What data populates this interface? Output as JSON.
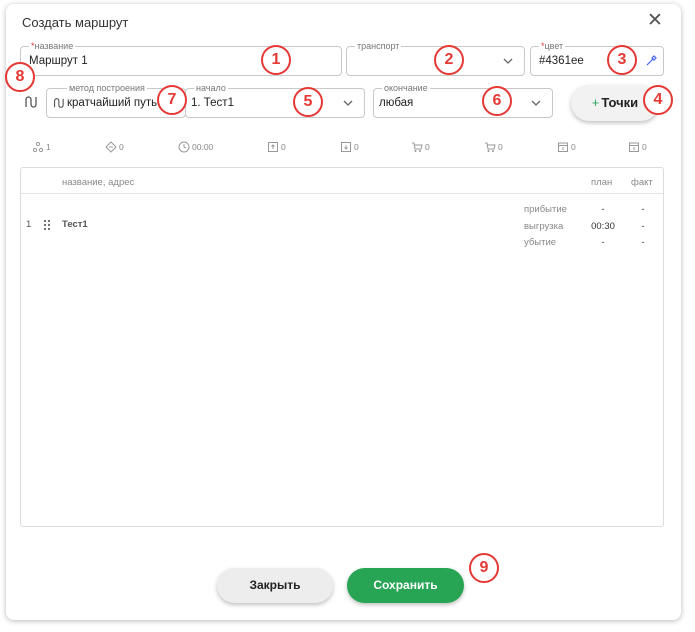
{
  "dialog": {
    "title": "Создать маршрут",
    "close_icon": "close-icon"
  },
  "form": {
    "name": {
      "label": "название",
      "required": "*",
      "value": "Маршрут 1"
    },
    "transport": {
      "label": "транспорт",
      "value": ""
    },
    "color": {
      "label": "цвет",
      "required": "*",
      "value": "#4361ee",
      "icon": "eyedropper-icon"
    },
    "method": {
      "label": "метод построения",
      "value": "кратчайший путь",
      "icon": "route-icon"
    },
    "start": {
      "label": "начало",
      "value": "1. Тест1"
    },
    "end": {
      "label": "окончание",
      "value": "любая"
    },
    "points_button": {
      "plus": "+",
      "label": "Точки"
    },
    "route_toggle_icon": "route-icon"
  },
  "stats": [
    {
      "icon": "points-count-icon",
      "value": "1"
    },
    {
      "icon": "distance-icon",
      "value": "0"
    },
    {
      "icon": "clock-icon",
      "value": "00:00"
    },
    {
      "icon": "load-icon",
      "value": "0"
    },
    {
      "icon": "unload-icon",
      "value": "0"
    },
    {
      "icon": "cart-load-icon",
      "value": "0"
    },
    {
      "icon": "cart-unload-icon",
      "value": "0"
    },
    {
      "icon": "box-in-icon",
      "value": "0"
    },
    {
      "icon": "box-out-icon",
      "value": "0"
    }
  ],
  "table": {
    "headers": {
      "name": "название, адрес",
      "plan": "план",
      "fact": "факт"
    },
    "rows": [
      {
        "num": "1",
        "name": "Тест1",
        "labels": [
          "прибытие",
          "выгрузка",
          "убытие"
        ],
        "plan": [
          "-",
          "00:30",
          "-"
        ],
        "fact": [
          "-",
          "-",
          "-"
        ]
      }
    ]
  },
  "buttons": {
    "close": "Закрыть",
    "save": "Сохранить"
  },
  "annotations": [
    "1",
    "2",
    "3",
    "4",
    "5",
    "6",
    "7",
    "8",
    "9"
  ],
  "colors": {
    "accent_green": "#27a555",
    "badge_red": "#e53935",
    "route_color": "#4361ee"
  }
}
